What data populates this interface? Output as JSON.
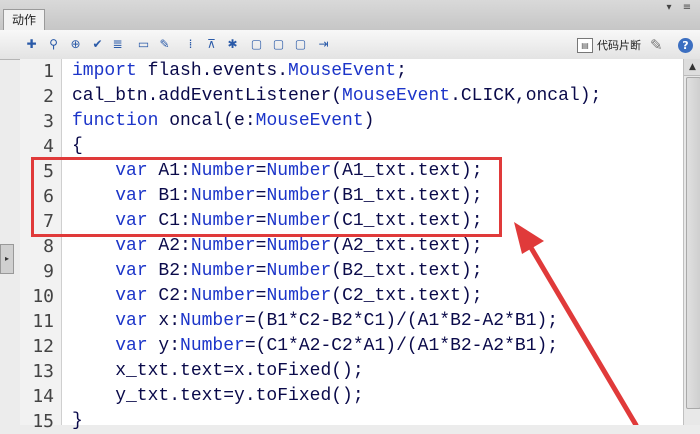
{
  "panel": {
    "tab_label": "动作",
    "panel_buttons": [
      "▾",
      "≡"
    ]
  },
  "toolbar": {
    "icons": [
      "add-script-icon",
      "find-icon",
      "target-path-icon",
      "check-syntax-icon",
      "auto-format-icon",
      "code-hint-icon",
      "debug-options-icon",
      "collapse-braces-icon",
      "collapse-selection-icon",
      "expand-all-icon",
      "apply-block-comment-icon",
      "apply-line-comment-icon",
      "remove-comment-icon",
      "show-hide-toolbox-icon"
    ],
    "snippets_label": "代码片断",
    "help_glyph": "?"
  },
  "side_handle": "▸",
  "code_lines": [
    {
      "num": "1",
      "text": "import flash.events.MouseEvent;"
    },
    {
      "num": "2",
      "text": "cal_btn.addEventListener(MouseEvent.CLICK,oncal);"
    },
    {
      "num": "3",
      "text": "function oncal(e:MouseEvent)"
    },
    {
      "num": "4",
      "text": "{"
    },
    {
      "num": "5",
      "text": "    var A1:Number=Number(A1_txt.text);"
    },
    {
      "num": "6",
      "text": "    var B1:Number=Number(B1_txt.text);"
    },
    {
      "num": "7",
      "text": "    var C1:Number=Number(C1_txt.text);"
    },
    {
      "num": "8",
      "text": "    var A2:Number=Number(A2_txt.text);"
    },
    {
      "num": "9",
      "text": "    var B2:Number=Number(B2_txt.text);"
    },
    {
      "num": "10",
      "text": "    var C2:Number=Number(C2_txt.text);"
    },
    {
      "num": "11",
      "text": "    var x:Number=(B1*C2-B2*C1)/(A1*B2-A2*B1);"
    },
    {
      "num": "12",
      "text": "    var y:Number=(C1*A2-C2*A1)/(A1*B2-A2*B1);"
    },
    {
      "num": "13",
      "text": "    x_txt.text=x.toFixed();"
    },
    {
      "num": "14",
      "text": "    y_txt.text=y.toFixed();"
    },
    {
      "num": "15",
      "text": "}"
    }
  ],
  "colors": {
    "highlight": "#e03a3a",
    "keyword": "#1c35c9",
    "code_text": "#0a0a4a"
  }
}
